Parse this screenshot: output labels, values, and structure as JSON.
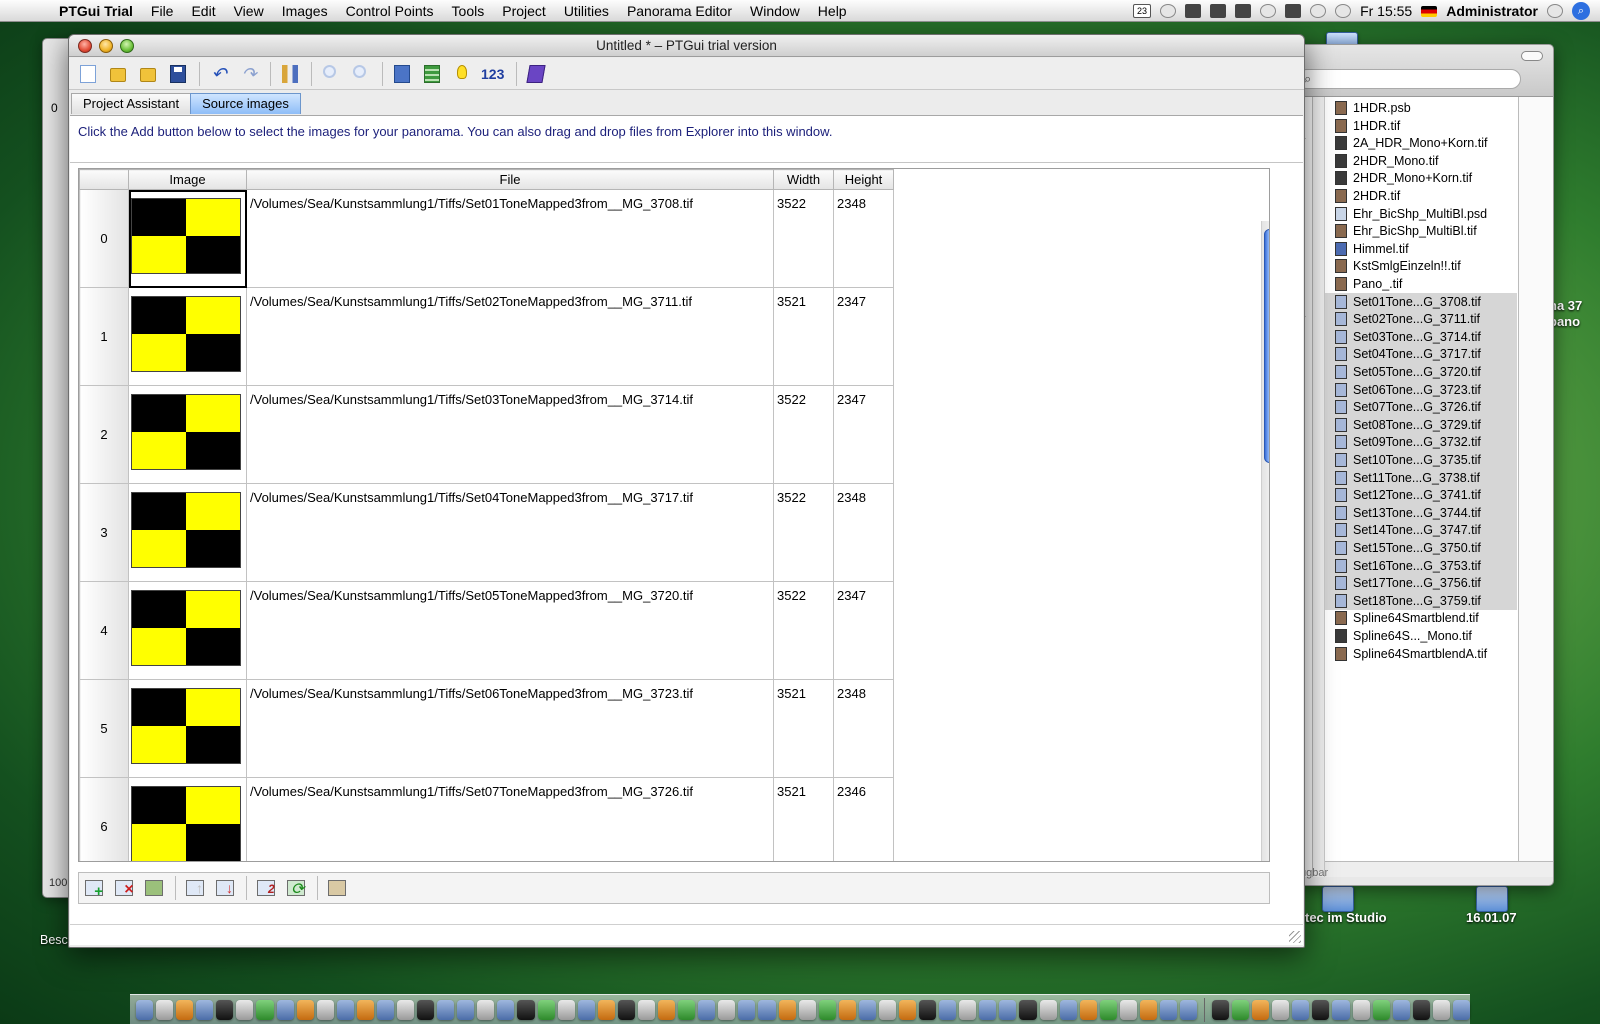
{
  "menubar": {
    "app_name": "PTGui Trial",
    "items": [
      "File",
      "Edit",
      "View",
      "Images",
      "Control Points",
      "Tools",
      "Project",
      "Utilities",
      "Panorama Editor",
      "Window",
      "Help"
    ],
    "calendar_day": "23",
    "clock": "Fr 15:55",
    "user": "Administrator"
  },
  "window": {
    "title": "Untitled * – PTGui trial version",
    "toolbar_number": "123",
    "tabs": [
      {
        "label": "Project Assistant",
        "active": false
      },
      {
        "label": "Source images",
        "active": true
      }
    ],
    "hint": "Click the Add button below to select the images for your panorama. You can also drag and drop files from Explorer into this window.",
    "table": {
      "headers": [
        "",
        "Image",
        "File",
        "Width",
        "Height"
      ],
      "rows": [
        {
          "index": "0",
          "file": "/Volumes/Sea/Kunstsammlung1/Tiffs/Set01ToneMapped3from__MG_3708.tif",
          "width": "3522",
          "height": "2348"
        },
        {
          "index": "1",
          "file": "/Volumes/Sea/Kunstsammlung1/Tiffs/Set02ToneMapped3from__MG_3711.tif",
          "width": "3521",
          "height": "2347"
        },
        {
          "index": "2",
          "file": "/Volumes/Sea/Kunstsammlung1/Tiffs/Set03ToneMapped3from__MG_3714.tif",
          "width": "3522",
          "height": "2347"
        },
        {
          "index": "3",
          "file": "/Volumes/Sea/Kunstsammlung1/Tiffs/Set04ToneMapped3from__MG_3717.tif",
          "width": "3522",
          "height": "2348"
        },
        {
          "index": "4",
          "file": "/Volumes/Sea/Kunstsammlung1/Tiffs/Set05ToneMapped3from__MG_3720.tif",
          "width": "3522",
          "height": "2347"
        },
        {
          "index": "5",
          "file": "/Volumes/Sea/Kunstsammlung1/Tiffs/Set06ToneMapped3from__MG_3723.tif",
          "width": "3521",
          "height": "2348"
        },
        {
          "index": "6",
          "file": "/Volumes/Sea/Kunstsammlung1/Tiffs/Set07ToneMapped3from__MG_3726.tif",
          "width": "3521",
          "height": "2346"
        }
      ]
    }
  },
  "finder": {
    "files": [
      {
        "name": "1HDR.psb",
        "selected": false
      },
      {
        "name": "1HDR.tif",
        "selected": false
      },
      {
        "name": "2A_HDR_Mono+Korn.tif",
        "selected": false
      },
      {
        "name": "2HDR_Mono.tif",
        "selected": false
      },
      {
        "name": "2HDR_Mono+Korn.tif",
        "selected": false
      },
      {
        "name": "2HDR.tif",
        "selected": false
      },
      {
        "name": "Ehr_BicShp_MultiBl.psd",
        "selected": false
      },
      {
        "name": "Ehr_BicShp_MultiBl.tif",
        "selected": false
      },
      {
        "name": "Himmel.tif",
        "selected": false
      },
      {
        "name": "KstSmlgEinzeln!!.tif",
        "selected": false
      },
      {
        "name": "Pano_.tif",
        "selected": false
      },
      {
        "name": "Set01Tone...G_3708.tif",
        "selected": true
      },
      {
        "name": "Set02Tone...G_3711.tif",
        "selected": true
      },
      {
        "name": "Set03Tone...G_3714.tif",
        "selected": true
      },
      {
        "name": "Set04Tone...G_3717.tif",
        "selected": true
      },
      {
        "name": "Set05Tone...G_3720.tif",
        "selected": true
      },
      {
        "name": "Set06Tone...G_3723.tif",
        "selected": true
      },
      {
        "name": "Set07Tone...G_3726.tif",
        "selected": true
      },
      {
        "name": "Set08Tone...G_3729.tif",
        "selected": true
      },
      {
        "name": "Set09Tone...G_3732.tif",
        "selected": true
      },
      {
        "name": "Set10Tone...G_3735.tif",
        "selected": true
      },
      {
        "name": "Set11Tone...G_3738.tif",
        "selected": true
      },
      {
        "name": "Set12Tone...G_3741.tif",
        "selected": true
      },
      {
        "name": "Set13Tone...G_3744.tif",
        "selected": true
      },
      {
        "name": "Set14Tone...G_3747.tif",
        "selected": true
      },
      {
        "name": "Set15Tone...G_3750.tif",
        "selected": true
      },
      {
        "name": "Set16Tone...G_3753.tif",
        "selected": true
      },
      {
        "name": "Set17Tone...G_3756.tif",
        "selected": true
      },
      {
        "name": "Set18Tone...G_3759.tif",
        "selected": true
      },
      {
        "name": "Spline64Smartblend.tif",
        "selected": false
      },
      {
        "name": "Spline64S..._Mono.tif",
        "selected": false
      },
      {
        "name": "Spline64SmartblendA.tif",
        "selected": false
      }
    ],
    "status": "fügbar"
  },
  "background_window": {
    "tab_fragment": "0",
    "zoom_fragment": "100"
  },
  "desktop": {
    "file_label": "Bescheinigung.jpg.zip",
    "volume1": "Altec im Studio",
    "volume2": "16.01.07",
    "side_text_1": "na 37",
    "side_text_2": "pano"
  }
}
